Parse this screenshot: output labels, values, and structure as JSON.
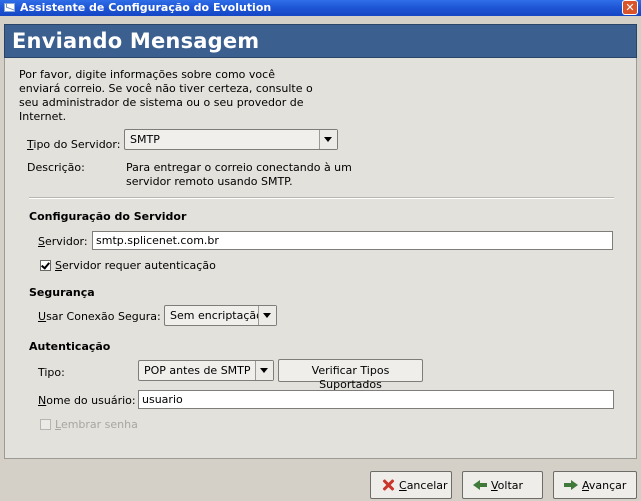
{
  "window": {
    "title": "Assistente de Configuração do Evolution",
    "close_symbol": "✕",
    "app_icon": "mail-envelope-icon",
    "close_icon": "close-icon"
  },
  "header": {
    "title": "Enviando Mensagem",
    "background_color": "#3b5f8f"
  },
  "intro_text": "Por favor, digite informações sobre como você enviará correio. Se você não tiver certeza, consulte o seu administrador de sistema ou o seu provedor de Internet.",
  "server_type": {
    "label": "Tipo do Servidor:",
    "value": "SMTP",
    "description_label": "Descrição:",
    "description_line1": "Para entregar o correio conectando à um",
    "description_line2": "servidor remoto usando SMTP."
  },
  "server_config": {
    "section_title": "Configuração do Servidor",
    "server_label": "Servidor:",
    "server_value": "smtp.splicenet.com.br",
    "auth_required_label": "Servidor requer autenticação",
    "auth_required_checked": true
  },
  "security": {
    "section_title": "Segurança",
    "secure_label": "Usar Conexão Segura:",
    "secure_value": "Sem encriptação"
  },
  "authentication": {
    "section_title": "Autenticação",
    "type_label": "Tipo:",
    "type_value": "POP antes de SMTP",
    "check_types_button": "Verificar Tipos Suportados",
    "username_label": "Nome do usuário:",
    "username_value": "usuario",
    "remember_password_label": "Lembrar senha",
    "remember_password_checked": false,
    "remember_password_enabled": false
  },
  "buttons": {
    "cancel": "Cancelar",
    "back": "Voltar",
    "forward": "Avançar"
  }
}
